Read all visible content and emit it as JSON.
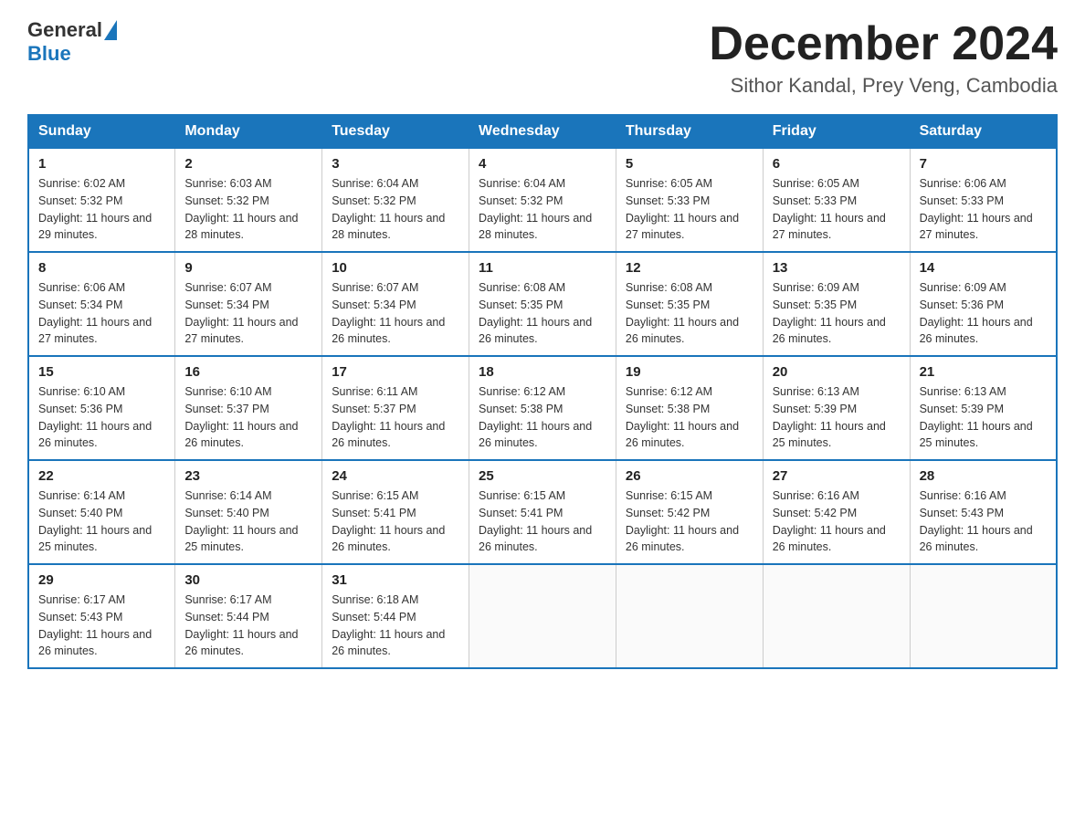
{
  "header": {
    "logo": {
      "general": "General",
      "blue": "Blue"
    },
    "title": "December 2024",
    "location": "Sithor Kandal, Prey Veng, Cambodia"
  },
  "weekdays": [
    "Sunday",
    "Monday",
    "Tuesday",
    "Wednesday",
    "Thursday",
    "Friday",
    "Saturday"
  ],
  "weeks": [
    [
      {
        "day": "1",
        "sunrise": "6:02 AM",
        "sunset": "5:32 PM",
        "daylight": "11 hours and 29 minutes."
      },
      {
        "day": "2",
        "sunrise": "6:03 AM",
        "sunset": "5:32 PM",
        "daylight": "11 hours and 28 minutes."
      },
      {
        "day": "3",
        "sunrise": "6:04 AM",
        "sunset": "5:32 PM",
        "daylight": "11 hours and 28 minutes."
      },
      {
        "day": "4",
        "sunrise": "6:04 AM",
        "sunset": "5:32 PM",
        "daylight": "11 hours and 28 minutes."
      },
      {
        "day": "5",
        "sunrise": "6:05 AM",
        "sunset": "5:33 PM",
        "daylight": "11 hours and 27 minutes."
      },
      {
        "day": "6",
        "sunrise": "6:05 AM",
        "sunset": "5:33 PM",
        "daylight": "11 hours and 27 minutes."
      },
      {
        "day": "7",
        "sunrise": "6:06 AM",
        "sunset": "5:33 PM",
        "daylight": "11 hours and 27 minutes."
      }
    ],
    [
      {
        "day": "8",
        "sunrise": "6:06 AM",
        "sunset": "5:34 PM",
        "daylight": "11 hours and 27 minutes."
      },
      {
        "day": "9",
        "sunrise": "6:07 AM",
        "sunset": "5:34 PM",
        "daylight": "11 hours and 27 minutes."
      },
      {
        "day": "10",
        "sunrise": "6:07 AM",
        "sunset": "5:34 PM",
        "daylight": "11 hours and 26 minutes."
      },
      {
        "day": "11",
        "sunrise": "6:08 AM",
        "sunset": "5:35 PM",
        "daylight": "11 hours and 26 minutes."
      },
      {
        "day": "12",
        "sunrise": "6:08 AM",
        "sunset": "5:35 PM",
        "daylight": "11 hours and 26 minutes."
      },
      {
        "day": "13",
        "sunrise": "6:09 AM",
        "sunset": "5:35 PM",
        "daylight": "11 hours and 26 minutes."
      },
      {
        "day": "14",
        "sunrise": "6:09 AM",
        "sunset": "5:36 PM",
        "daylight": "11 hours and 26 minutes."
      }
    ],
    [
      {
        "day": "15",
        "sunrise": "6:10 AM",
        "sunset": "5:36 PM",
        "daylight": "11 hours and 26 minutes."
      },
      {
        "day": "16",
        "sunrise": "6:10 AM",
        "sunset": "5:37 PM",
        "daylight": "11 hours and 26 minutes."
      },
      {
        "day": "17",
        "sunrise": "6:11 AM",
        "sunset": "5:37 PM",
        "daylight": "11 hours and 26 minutes."
      },
      {
        "day": "18",
        "sunrise": "6:12 AM",
        "sunset": "5:38 PM",
        "daylight": "11 hours and 26 minutes."
      },
      {
        "day": "19",
        "sunrise": "6:12 AM",
        "sunset": "5:38 PM",
        "daylight": "11 hours and 26 minutes."
      },
      {
        "day": "20",
        "sunrise": "6:13 AM",
        "sunset": "5:39 PM",
        "daylight": "11 hours and 25 minutes."
      },
      {
        "day": "21",
        "sunrise": "6:13 AM",
        "sunset": "5:39 PM",
        "daylight": "11 hours and 25 minutes."
      }
    ],
    [
      {
        "day": "22",
        "sunrise": "6:14 AM",
        "sunset": "5:40 PM",
        "daylight": "11 hours and 25 minutes."
      },
      {
        "day": "23",
        "sunrise": "6:14 AM",
        "sunset": "5:40 PM",
        "daylight": "11 hours and 25 minutes."
      },
      {
        "day": "24",
        "sunrise": "6:15 AM",
        "sunset": "5:41 PM",
        "daylight": "11 hours and 26 minutes."
      },
      {
        "day": "25",
        "sunrise": "6:15 AM",
        "sunset": "5:41 PM",
        "daylight": "11 hours and 26 minutes."
      },
      {
        "day": "26",
        "sunrise": "6:15 AM",
        "sunset": "5:42 PM",
        "daylight": "11 hours and 26 minutes."
      },
      {
        "day": "27",
        "sunrise": "6:16 AM",
        "sunset": "5:42 PM",
        "daylight": "11 hours and 26 minutes."
      },
      {
        "day": "28",
        "sunrise": "6:16 AM",
        "sunset": "5:43 PM",
        "daylight": "11 hours and 26 minutes."
      }
    ],
    [
      {
        "day": "29",
        "sunrise": "6:17 AM",
        "sunset": "5:43 PM",
        "daylight": "11 hours and 26 minutes."
      },
      {
        "day": "30",
        "sunrise": "6:17 AM",
        "sunset": "5:44 PM",
        "daylight": "11 hours and 26 minutes."
      },
      {
        "day": "31",
        "sunrise": "6:18 AM",
        "sunset": "5:44 PM",
        "daylight": "11 hours and 26 minutes."
      },
      null,
      null,
      null,
      null
    ]
  ]
}
